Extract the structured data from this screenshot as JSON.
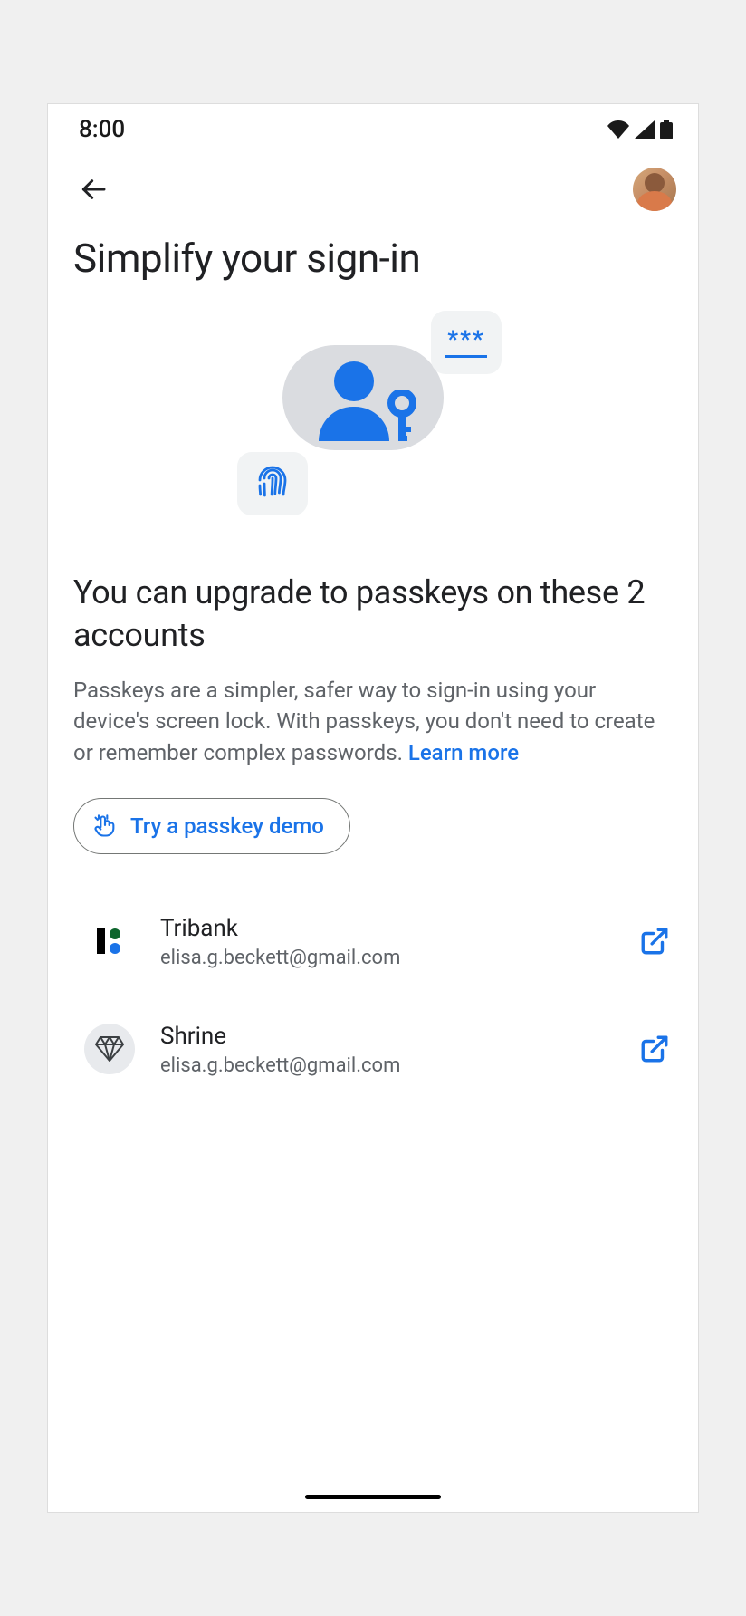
{
  "status": {
    "time": "8:00"
  },
  "page": {
    "title": "Simplify your sign-in",
    "heading": "You can upgrade to passkeys on these 2 accounts",
    "body_prefix": "Passkeys are a simpler, safer way to sign-in using your device's screen lock. With passkeys, you don't need to create or remember complex passwords. ",
    "learn_more": "Learn more",
    "demo_button": "Try a passkey demo"
  },
  "accounts": [
    {
      "name": "Tribank",
      "email": "elisa.g.beckett@gmail.com"
    },
    {
      "name": "Shrine",
      "email": "elisa.g.beckett@gmail.com"
    }
  ],
  "icons": {
    "password_asterisks": "***"
  }
}
